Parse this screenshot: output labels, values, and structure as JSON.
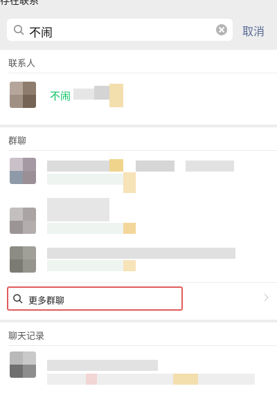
{
  "top_fragment": "存在联系",
  "search": {
    "query": "不闹",
    "cancel_label": "取消"
  },
  "sections": {
    "contacts_title": "联系人",
    "groups_title": "群聊",
    "history_title": "聊天记录"
  },
  "contact": {
    "name_visible": "不闹"
  },
  "more_groups_label": "更多群聊",
  "colors": {
    "accent_green": "#07c160",
    "link_blue": "#576b95",
    "highlight_red": "#e05b5b"
  },
  "icons": [
    "search-icon",
    "clear-icon",
    "chevron-right-icon"
  ]
}
